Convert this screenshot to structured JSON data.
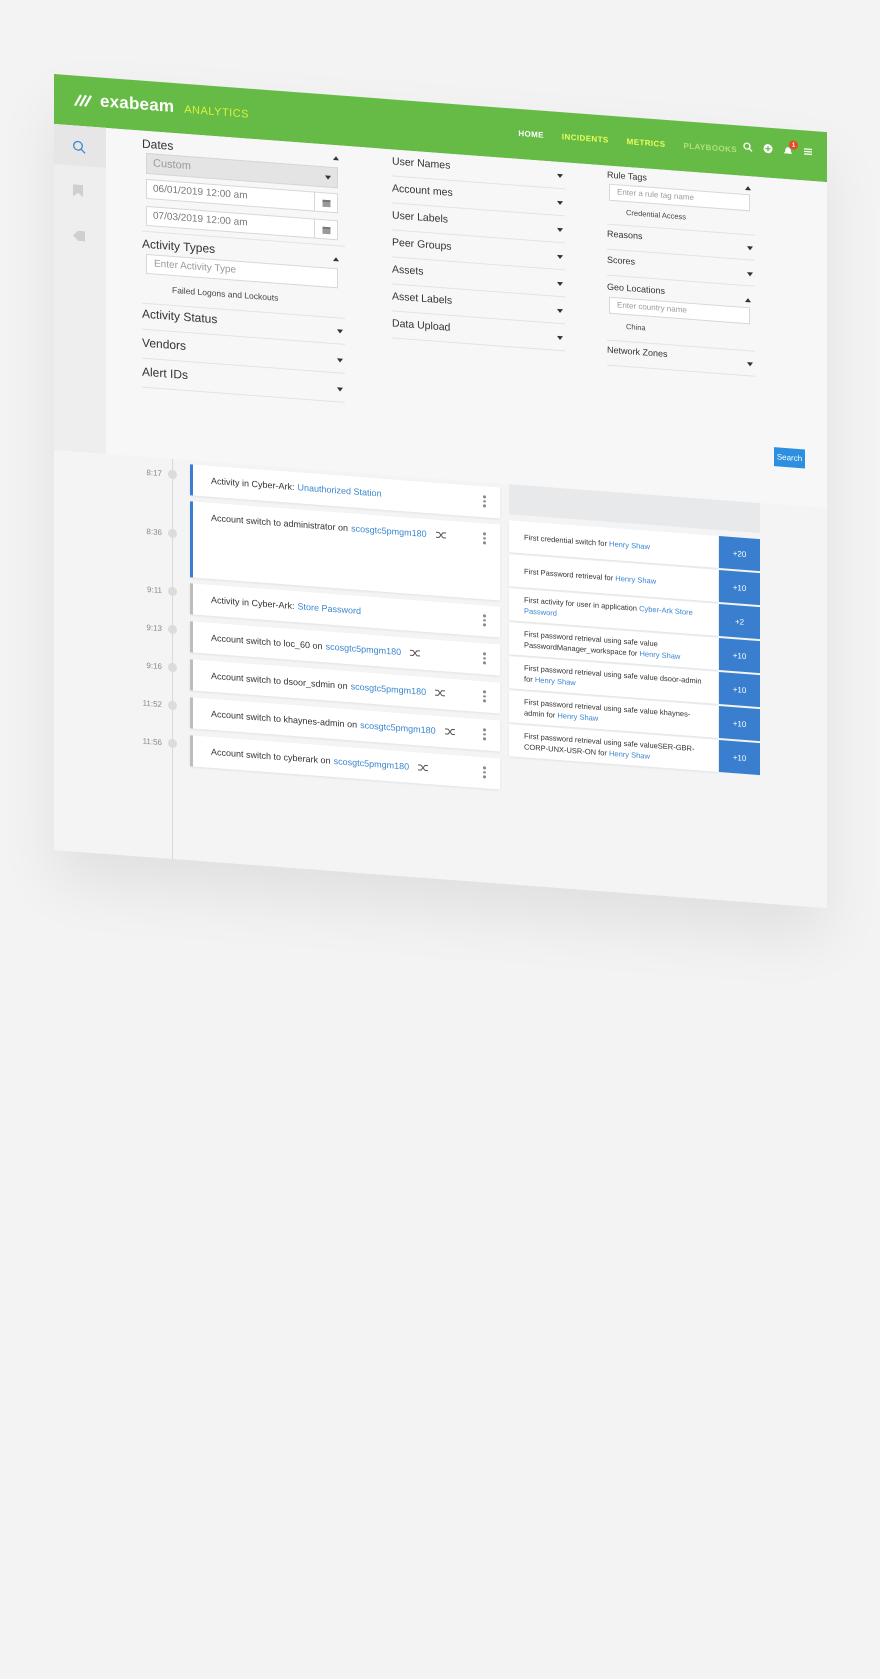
{
  "brand": {
    "name": "exabeam",
    "product": "ANALYTICS"
  },
  "nav": {
    "home": "HOME",
    "incidents": "INCIDENTS",
    "metrics": "METRICS",
    "playbooks": "PLAYBOOKS"
  },
  "notifications": {
    "count": "1"
  },
  "filters": {
    "dates": {
      "title": "Dates",
      "range": "Custom",
      "start": "06/01/2019 12:00 am",
      "end": "07/03/2019 12:00 am"
    },
    "activity_types": {
      "title": "Activity Types",
      "placeholder": "Enter Activity Type",
      "selected": "Failed Logons and Lockouts"
    },
    "activity_status": "Activity Status",
    "vendors": "Vendors",
    "alert_ids": "Alert IDs",
    "middle": [
      "User Names",
      "Account mes",
      "User Labels",
      "Peer Groups",
      "Assets",
      "Asset Labels",
      "Data Upload"
    ],
    "rule_tags": {
      "title": "Rule Tags",
      "placeholder": "Enter a rule tag name",
      "selected": "Credential Access"
    },
    "reasons": "Reasons",
    "scores": "Scores",
    "geo": {
      "title": "Geo Locations",
      "placeholder": "Enter country name",
      "selected": "China"
    },
    "network_zones": "Network Zones",
    "search_button": "Search"
  },
  "timeline": {
    "times": [
      "8:17",
      "8:36",
      "9:11",
      "9:13",
      "9:16",
      "11:52",
      "11:56"
    ],
    "events": [
      {
        "text": "Activity in Cyber-Ark:",
        "link": "Unauthorized Station"
      },
      {
        "text": "Account switch to administrator on",
        "link": "scosgtc5pmgm180"
      },
      {
        "text": "Activity in Cyber-Ark:",
        "link": "Store Password"
      },
      {
        "text": "Account switch to loc_60 on",
        "link": "scosgtc5pmgm180"
      },
      {
        "text": "Account switch to dsoor_sdmin on",
        "link": "scosgtc5pmgm180"
      },
      {
        "text": "Account switch to khaynes-admin on",
        "link": "scosgtc5pmgm180"
      },
      {
        "text": "Account switch to cyberark on",
        "link": "scosgtc5pmgm180"
      }
    ],
    "risks": [
      {
        "text": "First credential switch for",
        "link": "Henry Shaw",
        "score": "+20"
      },
      {
        "text": "First Password retrieval for",
        "link": "Henry Shaw",
        "score": "+10"
      },
      {
        "text": "First activity for user in application",
        "link": "Cyber-Ark Store Password",
        "score": "+2"
      },
      {
        "text": "First password retrieval using safe value PasswordManager_workspace for",
        "link": "Henry Shaw",
        "score": "+10"
      },
      {
        "text": "First password retrieval using safe value dsoor-admin for",
        "link": "Henry Shaw",
        "score": "+10"
      },
      {
        "text": "First password retrieval using safe value khaynes-admin for",
        "link": "Henry Shaw",
        "score": "+10"
      },
      {
        "text": "First password retrieval using safe valueSER-GBR-CORP-UNX-USR-ON for",
        "link": "Henry Shaw",
        "score": "+10"
      }
    ]
  }
}
